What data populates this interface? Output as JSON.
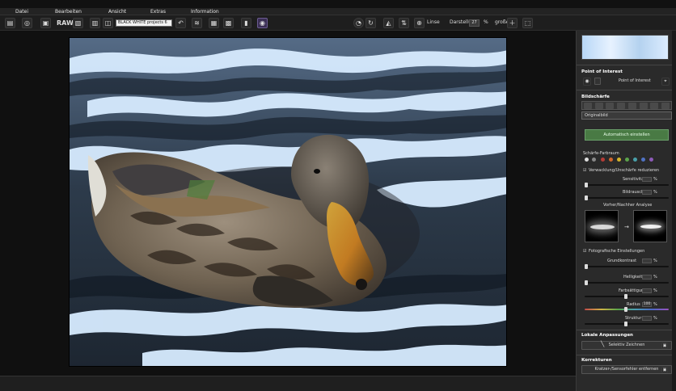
{
  "menu": {
    "items": [
      "Datei",
      "Bearbeiten",
      "Ansicht",
      "Extras",
      "Information"
    ]
  },
  "toolbar": {
    "raw_label": "RAW",
    "preset_select": "BLACK WHITE projects 6",
    "zoom_label": "Linse",
    "zoom_value_label": "Darstellung",
    "zoom_value": "27",
    "zoom_unit": "%",
    "grid_label": "große"
  },
  "panel": {
    "section_point": "Point of Interest",
    "point_button": "Point of Interest",
    "section_sharpness": "Bildschärfe",
    "dropdown_value": "Originalbild",
    "auto_button": "Automatisch einstellen",
    "color_space_label": "Schärfe-Farbraum",
    "checkbox_blur": "Verwacklung/Unschärfe reduzieren",
    "slider_sensitivity_label": "Sensitivität",
    "slider_noise_label": "Bildrauschen",
    "analysis_label": "Vorher/Nachher Analyse",
    "checkbox_photo": "Fotografische Einstellungen",
    "slider_contrast_label": "Grundkontrast",
    "slider_brightness_label": "Helligkeit",
    "slider_sat_label": "Farbsättigung",
    "slider_radius_label": "Radius",
    "radius_value": "100",
    "slider_structure_label": "Struktur",
    "section_local": "Lokale Anpassungen",
    "local_button": "Selektiv Zeichnen",
    "section_corrections": "Korrekturen",
    "corrections_button": "Kratzer-/Sensorfehler entfernen",
    "percent_unit": "%"
  }
}
